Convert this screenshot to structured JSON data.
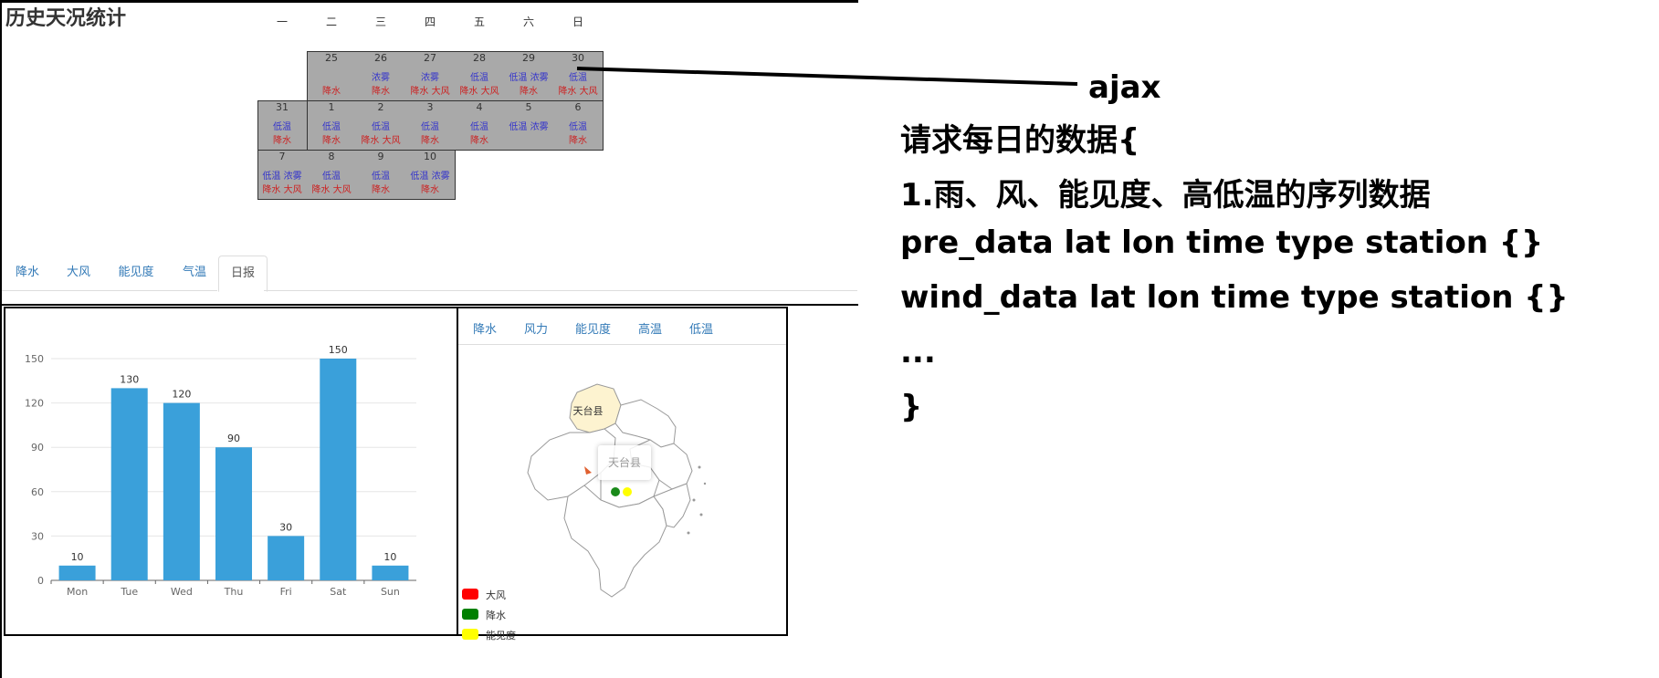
{
  "title": "历史天况统计",
  "weekdays": [
    "一",
    "二",
    "三",
    "四",
    "五",
    "六",
    "日"
  ],
  "calendar": [
    {
      "date": "25",
      "l1": "",
      "l2": "降水"
    },
    {
      "date": "26",
      "l1": "浓雾",
      "l2": "降水"
    },
    {
      "date": "27",
      "l1": "浓雾",
      "l2": "降水 大风"
    },
    {
      "date": "28",
      "l1": "低温",
      "l2": "降水 大风"
    },
    {
      "date": "29",
      "l1": "低温 浓雾",
      "l2": "降水"
    },
    {
      "date": "30",
      "l1": "低温",
      "l2": "降水 大风"
    },
    {
      "date": "31",
      "l1": "低温",
      "l2": "降水"
    },
    {
      "date": "1",
      "l1": "低温",
      "l2": "降水"
    },
    {
      "date": "2",
      "l1": "低温",
      "l2": "降水 大风"
    },
    {
      "date": "3",
      "l1": "低温",
      "l2": "降水"
    },
    {
      "date": "4",
      "l1": "低温",
      "l2": "降水"
    },
    {
      "date": "5",
      "l1": "低温 浓雾",
      "l2": ""
    },
    {
      "date": "6",
      "l1": "低温",
      "l2": "降水"
    },
    {
      "date": "7",
      "l1": "低温 浓雾",
      "l2": "降水 大风"
    },
    {
      "date": "8",
      "l1": "低温",
      "l2": "降水 大风"
    },
    {
      "date": "9",
      "l1": "低温",
      "l2": "降水"
    },
    {
      "date": "10",
      "l1": "低温 浓雾",
      "l2": "降水"
    }
  ],
  "tabs": [
    "降水",
    "大风",
    "能见度",
    "气温",
    "日报"
  ],
  "active_tab": "日报",
  "chart_data": {
    "type": "bar",
    "categories": [
      "Mon",
      "Tue",
      "Wed",
      "Thu",
      "Fri",
      "Sat",
      "Sun"
    ],
    "values": [
      10,
      130,
      120,
      90,
      30,
      150,
      10
    ],
    "yticks": [
      0,
      30,
      60,
      90,
      120,
      150
    ],
    "ylim": [
      0,
      150
    ],
    "color": "#3aa0da",
    "grid": true,
    "title": "",
    "xlabel": "",
    "ylabel": ""
  },
  "map": {
    "tabs": [
      "降水",
      "风力",
      "能见度",
      "高温",
      "低温"
    ],
    "county_label": "天台县",
    "tooltip": "天台县",
    "highlight_color": "#fdf3d0",
    "legend": [
      {
        "label": "大风",
        "color": "#ff0000"
      },
      {
        "label": "降水",
        "color": "#008000"
      },
      {
        "label": "能见度",
        "color": "#ffff00"
      }
    ]
  },
  "notes": {
    "ajax": "ajax",
    "lines": [
      "请求每日的数据{",
      "1.雨、风、能见度、高低温的序列数据",
      "pre_data lat lon time type station {}",
      "wind_data lat lon time type station {}",
      "...",
      "}"
    ]
  }
}
